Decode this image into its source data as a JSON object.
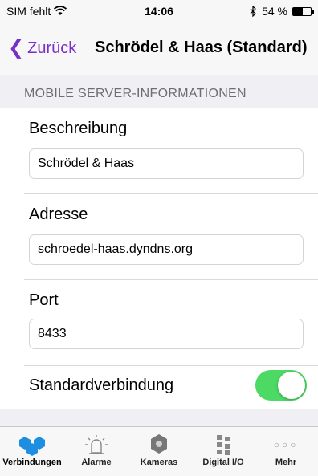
{
  "status_bar": {
    "carrier": "SIM fehlt",
    "time": "14:06",
    "battery_percent": "54 %",
    "battery_level": 0.54
  },
  "nav": {
    "back_label": "Zurück",
    "title": "Schrödel & Haas (Standard)",
    "accent_color": "#7a2fc7"
  },
  "section": {
    "header": "MOBILE SERVER-INFORMATIONEN"
  },
  "form": {
    "description_label": "Beschreibung",
    "description_value": "Schrödel & Haas",
    "address_label": "Adresse",
    "address_value": "schroedel-haas.dyndns.org",
    "port_label": "Port",
    "port_value": "8433",
    "default_label": "Standardverbindung",
    "default_enabled": true,
    "toggle_color": "#4cd964"
  },
  "tabs": [
    {
      "label": "Verbindungen",
      "icon": "connections-icon",
      "active": true
    },
    {
      "label": "Alarme",
      "icon": "alarm-icon",
      "active": false
    },
    {
      "label": "Kameras",
      "icon": "camera-icon",
      "active": false
    },
    {
      "label": "Digital I/O",
      "icon": "digital-io-icon",
      "active": false
    },
    {
      "label": "Mehr",
      "icon": "more-icon",
      "active": false
    }
  ],
  "tab_active_color": "#1e8fe0"
}
